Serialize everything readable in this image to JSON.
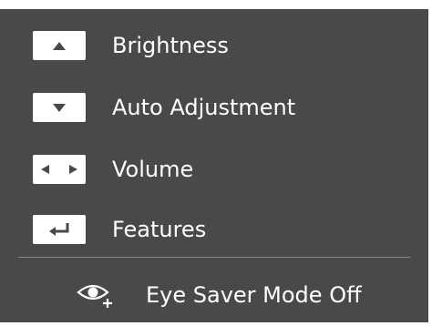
{
  "menu": {
    "items": [
      {
        "key_icon": "up-arrow-icon",
        "label": "Brightness"
      },
      {
        "key_icon": "down-arrow-icon",
        "label": "Auto Adjustment"
      },
      {
        "key_icon": "left-right-arrows-icon",
        "label": "Volume"
      },
      {
        "key_icon": "return-enter-icon",
        "label": "Features"
      }
    ]
  },
  "footer": {
    "icon": "eye-saver-icon",
    "label": "Eye Saver Mode Off"
  },
  "colors": {
    "background": "#494949",
    "text": "#ffffff",
    "key_badge": "#ffffff",
    "key_glyph": "#494949"
  }
}
